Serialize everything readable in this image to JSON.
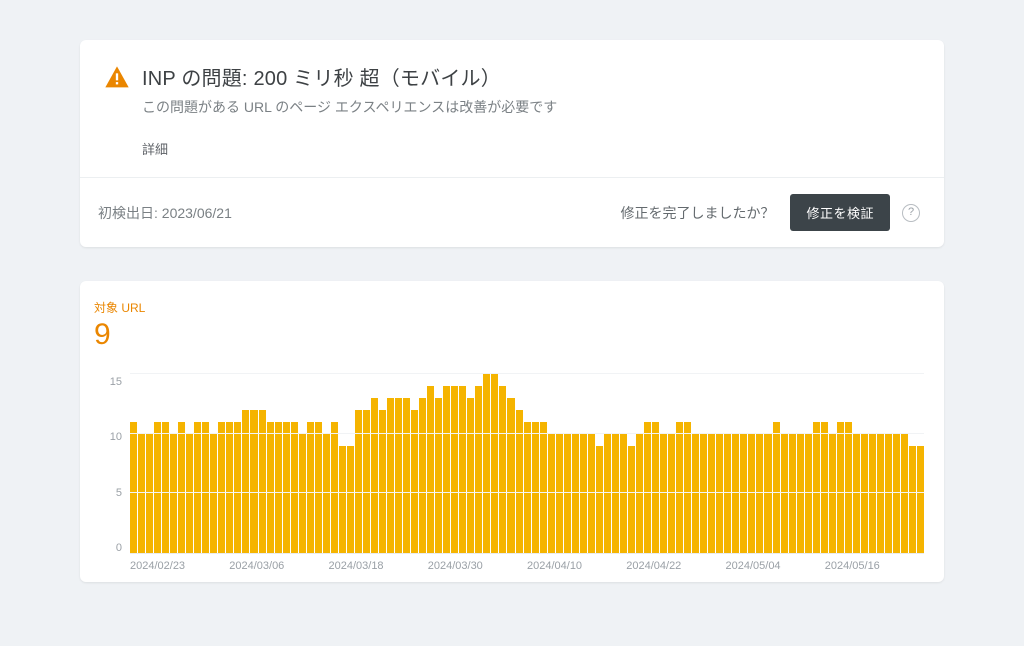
{
  "issue": {
    "title": "INP の問題: 200 ミリ秒 超（モバイル）",
    "subtitle": "この問題がある URL のページ エクスペリエンスは改善が必要です",
    "details_link": "詳細"
  },
  "footer": {
    "first_detected_label": "初検出日: ",
    "first_detected_date": "2023/06/21",
    "done_question": "修正を完了しましたか？",
    "validate_button": "修正を検証",
    "help_glyph": "?"
  },
  "metric": {
    "label": "対象 URL",
    "value": "9"
  },
  "colors": {
    "accent_orange": "#ea8600",
    "bar_orange": "#f5b400",
    "button_bg": "#3c4449"
  },
  "chart_data": {
    "type": "bar",
    "title": "対象 URL",
    "xlabel": "",
    "ylabel": "",
    "ylim": [
      0,
      15
    ],
    "y_ticks": [
      15,
      10,
      5,
      0
    ],
    "x_tick_labels": [
      "2024/02/23",
      "2024/03/06",
      "2024/03/18",
      "2024/03/30",
      "2024/04/10",
      "2024/04/22",
      "2024/05/04",
      "2024/05/16"
    ],
    "values": [
      11,
      10,
      10,
      11,
      11,
      10,
      11,
      10,
      11,
      11,
      10,
      11,
      11,
      11,
      12,
      12,
      12,
      11,
      11,
      11,
      11,
      10,
      11,
      11,
      10,
      11,
      9,
      9,
      12,
      12,
      13,
      12,
      13,
      13,
      13,
      12,
      13,
      14,
      13,
      14,
      14,
      14,
      13,
      14,
      15,
      15,
      14,
      13,
      12,
      11,
      11,
      11,
      10,
      10,
      10,
      10,
      10,
      10,
      9,
      10,
      10,
      10,
      9,
      10,
      11,
      11,
      10,
      10,
      11,
      11,
      10,
      10,
      10,
      10,
      10,
      10,
      10,
      10,
      10,
      10,
      11,
      10,
      10,
      10,
      10,
      11,
      11,
      10,
      11,
      11,
      10,
      10,
      10,
      10,
      10,
      10,
      10,
      9,
      9
    ]
  }
}
